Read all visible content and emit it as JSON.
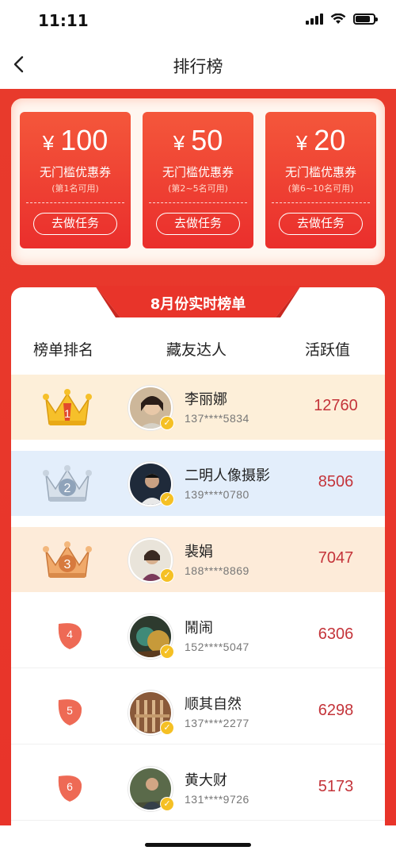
{
  "status_bar": {
    "time": "11:11"
  },
  "nav": {
    "title": "排行榜"
  },
  "coupons": [
    {
      "currency": "¥",
      "amount": "100",
      "desc": "无门槛优惠券",
      "note": "(第1名可用)",
      "button": "去做任务"
    },
    {
      "currency": "¥",
      "amount": "50",
      "desc": "无门槛优惠券",
      "note": "(第2~5名可用)",
      "button": "去做任务"
    },
    {
      "currency": "¥",
      "amount": "20",
      "desc": "无门槛优惠券",
      "note": "(第6~10名可用)",
      "button": "去做任务"
    }
  ],
  "ranking": {
    "banner": "8月份实时榜单",
    "headers": {
      "rank": "榜单排名",
      "user": "藏友达人",
      "active": "活跃值"
    },
    "rows": [
      {
        "rank": "1",
        "name": "李丽娜",
        "phone": "137****5834",
        "score": "12760"
      },
      {
        "rank": "2",
        "name": "二明人像摄影",
        "phone": "139****0780",
        "score": "8506"
      },
      {
        "rank": "3",
        "name": "裴娟",
        "phone": "188****8869",
        "score": "7047"
      },
      {
        "rank": "4",
        "name": "鬧闹",
        "phone": "152****5047",
        "score": "6306"
      },
      {
        "rank": "5",
        "name": "顺其自然",
        "phone": "137****2277",
        "score": "6298"
      },
      {
        "rank": "6",
        "name": "黄大财",
        "phone": "131****9726",
        "score": "5173"
      }
    ]
  },
  "colors": {
    "brand_red": "#e8342a",
    "score_red": "#c4343a",
    "gold": "#f5c024"
  }
}
